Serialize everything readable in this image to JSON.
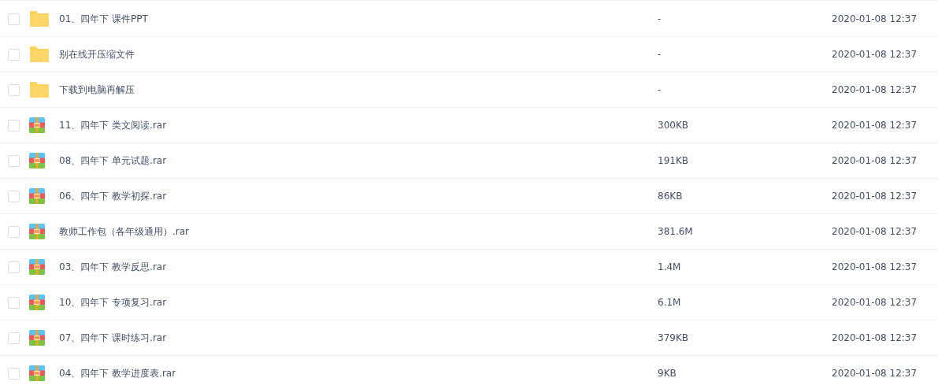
{
  "files": [
    {
      "kind": "folder",
      "checked": false,
      "name": "01、四年下 课件PPT",
      "size": "-",
      "modified": "2020-01-08 12:37"
    },
    {
      "kind": "folder",
      "checked": false,
      "name": "别在线开压缩文件",
      "size": "-",
      "modified": "2020-01-08 12:37"
    },
    {
      "kind": "folder",
      "checked": false,
      "name": "下载到电脑再解压",
      "size": "-",
      "modified": "2020-01-08 12:37"
    },
    {
      "kind": "archive",
      "checked": false,
      "name": "11、四年下 类文阅读.rar",
      "size": "300KB",
      "modified": "2020-01-08 12:37"
    },
    {
      "kind": "archive",
      "checked": false,
      "name": "08、四年下 单元试题.rar",
      "size": "191KB",
      "modified": "2020-01-08 12:37"
    },
    {
      "kind": "archive",
      "checked": false,
      "name": "06、四年下 教学初探.rar",
      "size": "86KB",
      "modified": "2020-01-08 12:37"
    },
    {
      "kind": "archive",
      "checked": false,
      "name": "教师工作包（各年级通用）.rar",
      "size": "381.6M",
      "modified": "2020-01-08 12:37"
    },
    {
      "kind": "archive",
      "checked": false,
      "name": "03、四年下 教学反思.rar",
      "size": "1.4M",
      "modified": "2020-01-08 12:37"
    },
    {
      "kind": "archive",
      "checked": false,
      "name": "10、四年下 专项复习.rar",
      "size": "6.1M",
      "modified": "2020-01-08 12:37"
    },
    {
      "kind": "archive",
      "checked": false,
      "name": "07、四年下 课时练习.rar",
      "size": "379KB",
      "modified": "2020-01-08 12:37"
    },
    {
      "kind": "archive",
      "checked": false,
      "name": "04、四年下 教学进度表.rar",
      "size": "9KB",
      "modified": "2020-01-08 12:37"
    }
  ]
}
